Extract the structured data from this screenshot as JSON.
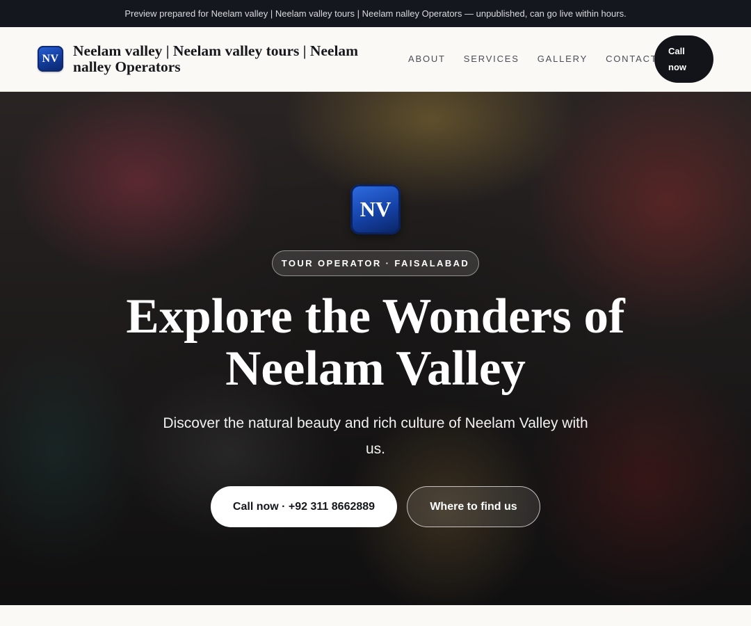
{
  "banner": {
    "text": "Preview prepared for Neelam valley | Neelam valley tours | Neelam nalley Operators — unpublished, can go live within hours."
  },
  "header": {
    "logo_text": "NV",
    "brand_name": "Neelam valley | Neelam valley tours | Neelam nalley Operators",
    "nav": [
      {
        "label": "ABOUT"
      },
      {
        "label": "SERVICES"
      },
      {
        "label": "GALLERY"
      },
      {
        "label": "CONTACT"
      }
    ],
    "cta_label": "Call now"
  },
  "hero": {
    "logo_text": "NV",
    "kicker": "TOUR OPERATOR · FAISALABAD",
    "title": "Explore the Wonders of Neelam Valley",
    "subtitle": "Discover the natural beauty and rich culture of Neelam Valley with us.",
    "primary_button": "Call now · +92 311 8662889",
    "secondary_button": "Where to find us",
    "background_image": "market-stall-photo"
  },
  "colors": {
    "banner_bg": "#14171d",
    "page_bg": "#faf9f6",
    "logo_blue": "#1542a8",
    "cta_dark": "#121419",
    "text_dark": "#17181c"
  }
}
